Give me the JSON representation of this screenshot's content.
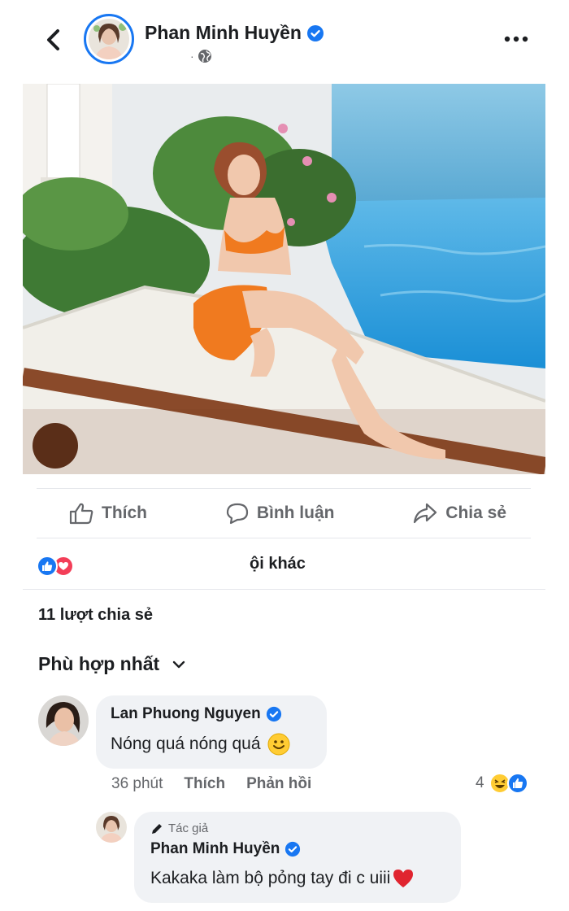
{
  "header": {
    "author_name": "Phan Minh Huyền",
    "privacy_dot": "·"
  },
  "actions": {
    "like": "Thích",
    "comment": "Bình luận",
    "share": "Chia sẻ"
  },
  "reactions": {
    "summary_text": "ội khác"
  },
  "shares_text": "11 lượt chia sẻ",
  "sort_label": "Phù hợp nhất",
  "comment": {
    "author": "Lan Phuong Nguyen",
    "text": "Nóng quá nóng quá",
    "time": "36 phút",
    "like": "Thích",
    "reply": "Phản hồi",
    "reaction_count": "4"
  },
  "reply": {
    "badge": "Tác giả",
    "author": "Phan Minh Huyền",
    "text": "Kakaka làm bộ pỏng tay đi c uiii"
  },
  "colors": {
    "accent": "#1877f2",
    "text": "#1c1e21",
    "muted": "#65676b",
    "bubble": "#f0f2f5"
  }
}
